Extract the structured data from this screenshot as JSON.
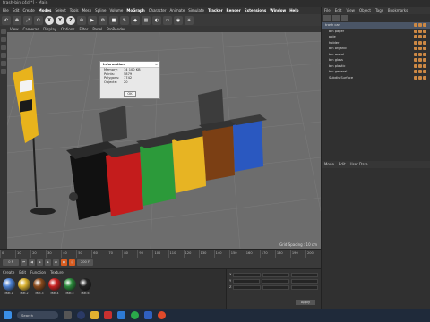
{
  "window": {
    "title": "trash-bin.c4d *] - Main"
  },
  "menu": [
    "File",
    "Edit",
    "Create",
    "Modes",
    "Select",
    "Tools",
    "Mesh",
    "Spline",
    "Volume",
    "MoGraph",
    "Character",
    "Animate",
    "Simulate",
    "Tracker",
    "Render",
    "Extensions",
    "Window",
    "Help"
  ],
  "menu_highlight": [
    "Modes",
    "MoGraph",
    "Tracker",
    "Render",
    "Extensions",
    "Window",
    "Help"
  ],
  "toolbar": {
    "xyz": [
      "X",
      "Y",
      "Z"
    ]
  },
  "viewport_menu": [
    "View",
    "Cameras",
    "Display",
    "Options",
    "Filter",
    "Panel",
    "ProRender"
  ],
  "viewport": {
    "grid_spacing": "Grid Spacing : 10 cm"
  },
  "info_dialog": {
    "title": "Information",
    "rows": [
      {
        "label": "Memory:",
        "value": "14 100 KB"
      },
      {
        "label": "Points:",
        "value": "5879"
      },
      {
        "label": "Polygons:",
        "value": "7742"
      },
      {
        "label": "Objects:",
        "value": "20"
      }
    ],
    "ok_label": "OK"
  },
  "right_panel": {
    "menu": [
      "File",
      "Edit",
      "View",
      "Object",
      "Tags",
      "Bookmarks"
    ],
    "objects": [
      {
        "name": "trash can",
        "selected": true
      },
      {
        "name": "bin paper",
        "selected": false
      },
      {
        "name": "pole",
        "selected": false
      },
      {
        "name": "holder",
        "selected": false
      },
      {
        "name": "bin organic",
        "selected": false
      },
      {
        "name": "bin metal",
        "selected": false
      },
      {
        "name": "bin glass",
        "selected": false
      },
      {
        "name": "bin plastic",
        "selected": false
      },
      {
        "name": "bin general",
        "selected": false
      },
      {
        "name": "Subdiv Surface",
        "selected": false
      }
    ],
    "attr_menu": [
      "Mode",
      "Edit",
      "User Data"
    ]
  },
  "timeline": {
    "ticks": [
      "0",
      "10",
      "20",
      "30",
      "40",
      "50",
      "60",
      "70",
      "80",
      "90",
      "100",
      "110",
      "120",
      "130",
      "140",
      "150",
      "160",
      "170",
      "180",
      "190",
      "200"
    ],
    "frame": "0 F",
    "end_frame": "200 F"
  },
  "materials": {
    "menu": [
      "Create",
      "Edit",
      "Function",
      "Texture"
    ],
    "items": [
      {
        "name": "Mat.1",
        "color": "#4a7fd0"
      },
      {
        "name": "Mat.2",
        "color": "#d8b030"
      },
      {
        "name": "Mat.3",
        "color": "#8a4a1c"
      },
      {
        "name": "Mat.4",
        "color": "#c82020"
      },
      {
        "name": "Mat.5",
        "color": "#2a8a3a"
      },
      {
        "name": "Mat.6",
        "color": "#222222"
      }
    ]
  },
  "coords": {
    "rows": [
      "X",
      "Y",
      "Z"
    ],
    "apply_label": "Apply"
  },
  "taskbar": {
    "search_placeholder": "Search"
  }
}
